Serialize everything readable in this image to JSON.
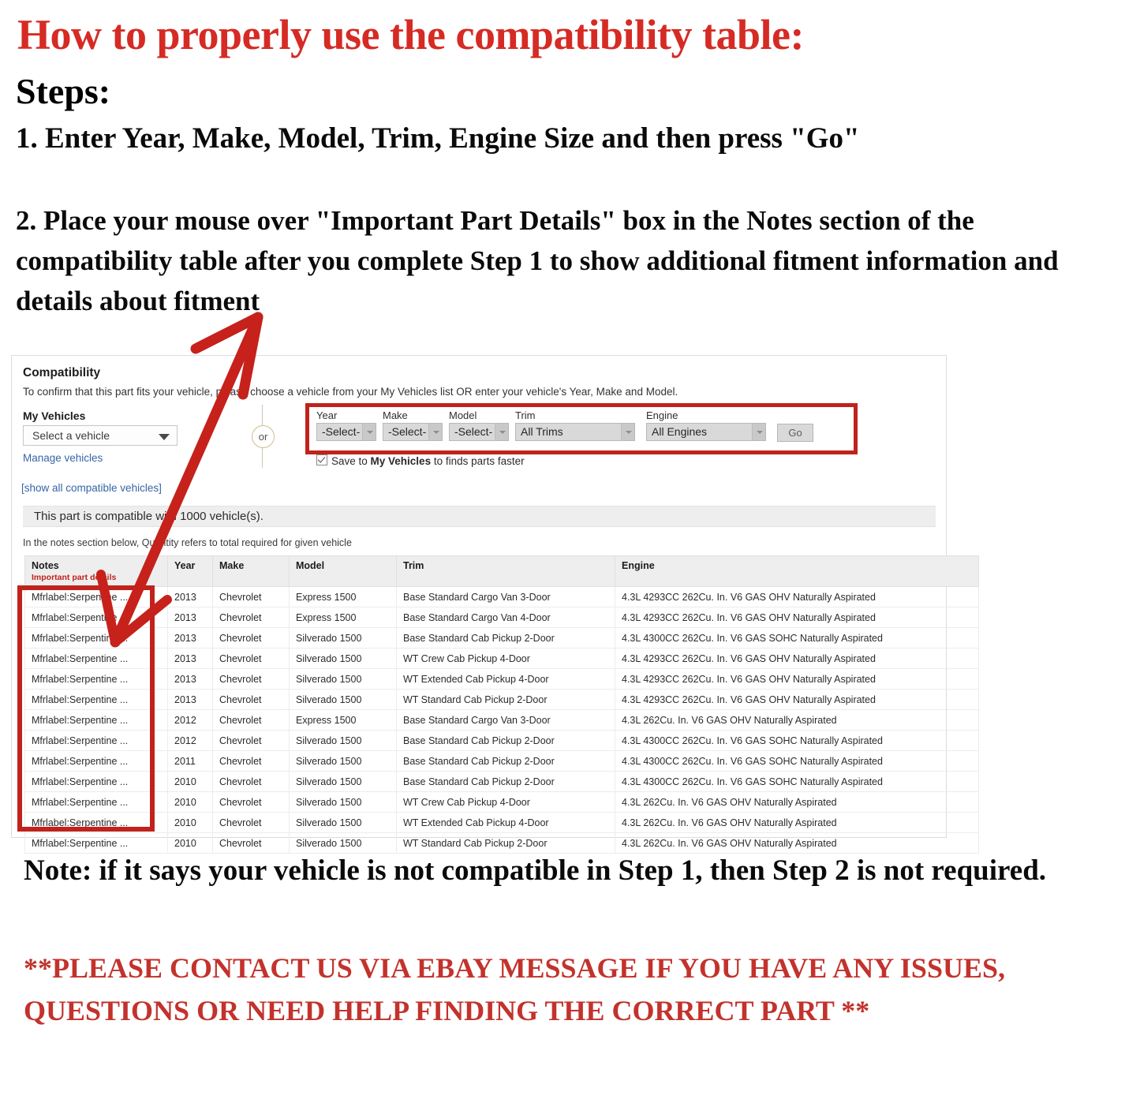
{
  "headline": "How to properly use the compatibility table:",
  "steps_label": "Steps:",
  "step1": "1. Enter Year, Make, Model, Trim, Engine Size and then press \"Go\"",
  "step2": "2. Place your mouse over \"Important Part Details\" box in the Notes section of the compatibility table after you complete Step 1 to show additional fitment information and details about fitment",
  "bottom_note": "Note: if it says your vehicle is not compatible in Step 1, then Step 2 is not required.",
  "contact_note": "**PLEASE CONTACT US VIA EBAY MESSAGE IF YOU HAVE ANY ISSUES, QUESTIONS OR NEED HELP FINDING THE CORRECT PART **",
  "colors": {
    "accent_red": "#c0221c",
    "headline_red": "#d52b24",
    "link_blue": "#3665a6",
    "banner_gray": "#eeeeee"
  },
  "panel": {
    "title": "Compatibility",
    "subtitle": "To confirm that this part fits your vehicle, please choose a vehicle from your My Vehicles list OR enter your vehicle's Year, Make and Model.",
    "my_vehicles_label": "My Vehicles",
    "vehicle_select_value": "Select a vehicle",
    "manage_vehicles_link": "Manage vehicles",
    "show_all_link": "[show all compatible vehicles]",
    "or_badge": "or",
    "compatible_banner": "This part is compatible with 1000 vehicle(s).",
    "quantity_note": "In the notes section below, Quantity refers to total required for given vehicle",
    "finder": {
      "fields": [
        {
          "label": "Year",
          "value": "-Select-"
        },
        {
          "label": "Make",
          "value": "-Select-"
        },
        {
          "label": "Model",
          "value": "-Select-"
        },
        {
          "label": "Trim",
          "value": "All Trims"
        },
        {
          "label": "Engine",
          "value": "All Engines"
        }
      ],
      "go_label": "Go",
      "save_prefix": "Save to ",
      "save_bold": "My Vehicles",
      "save_suffix": " to finds parts faster",
      "save_checked": true
    }
  },
  "table": {
    "headers": {
      "notes": "Notes",
      "notes_sub": "Important part details",
      "year": "Year",
      "make": "Make",
      "model": "Model",
      "trim": "Trim",
      "engine": "Engine"
    },
    "rows": [
      {
        "notes": "Mfrlabel:Serpentine ...",
        "year": "2013",
        "make": "Chevrolet",
        "model": "Express 1500",
        "trim": "Base Standard Cargo Van 3-Door",
        "engine": "4.3L 4293CC 262Cu. In. V6 GAS OHV Naturally Aspirated"
      },
      {
        "notes": "Mfrlabel:Serpentine ...",
        "year": "2013",
        "make": "Chevrolet",
        "model": "Express 1500",
        "trim": "Base Standard Cargo Van 4-Door",
        "engine": "4.3L 4293CC 262Cu. In. V6 GAS OHV Naturally Aspirated"
      },
      {
        "notes": "Mfrlabel:Serpentine ...",
        "year": "2013",
        "make": "Chevrolet",
        "model": "Silverado 1500",
        "trim": "Base Standard Cab Pickup 2-Door",
        "engine": "4.3L 4300CC 262Cu. In. V6 GAS SOHC Naturally Aspirated"
      },
      {
        "notes": "Mfrlabel:Serpentine ...",
        "year": "2013",
        "make": "Chevrolet",
        "model": "Silverado 1500",
        "trim": "WT Crew Cab Pickup 4-Door",
        "engine": "4.3L 4293CC 262Cu. In. V6 GAS OHV Naturally Aspirated"
      },
      {
        "notes": "Mfrlabel:Serpentine ...",
        "year": "2013",
        "make": "Chevrolet",
        "model": "Silverado 1500",
        "trim": "WT Extended Cab Pickup 4-Door",
        "engine": "4.3L 4293CC 262Cu. In. V6 GAS OHV Naturally Aspirated"
      },
      {
        "notes": "Mfrlabel:Serpentine ...",
        "year": "2013",
        "make": "Chevrolet",
        "model": "Silverado 1500",
        "trim": "WT Standard Cab Pickup 2-Door",
        "engine": "4.3L 4293CC 262Cu. In. V6 GAS OHV Naturally Aspirated"
      },
      {
        "notes": "Mfrlabel:Serpentine ...",
        "year": "2012",
        "make": "Chevrolet",
        "model": "Express 1500",
        "trim": "Base Standard Cargo Van 3-Door",
        "engine": "4.3L 262Cu. In. V6 GAS OHV Naturally Aspirated"
      },
      {
        "notes": "Mfrlabel:Serpentine ...",
        "year": "2012",
        "make": "Chevrolet",
        "model": "Silverado 1500",
        "trim": "Base Standard Cab Pickup 2-Door",
        "engine": "4.3L 4300CC 262Cu. In. V6 GAS SOHC Naturally Aspirated"
      },
      {
        "notes": "Mfrlabel:Serpentine ...",
        "year": "2011",
        "make": "Chevrolet",
        "model": "Silverado 1500",
        "trim": "Base Standard Cab Pickup 2-Door",
        "engine": "4.3L 4300CC 262Cu. In. V6 GAS SOHC Naturally Aspirated"
      },
      {
        "notes": "Mfrlabel:Serpentine ...",
        "year": "2010",
        "make": "Chevrolet",
        "model": "Silverado 1500",
        "trim": "Base Standard Cab Pickup 2-Door",
        "engine": "4.3L 4300CC 262Cu. In. V6 GAS SOHC Naturally Aspirated"
      },
      {
        "notes": "Mfrlabel:Serpentine ...",
        "year": "2010",
        "make": "Chevrolet",
        "model": "Silverado 1500",
        "trim": "WT Crew Cab Pickup 4-Door",
        "engine": "4.3L 262Cu. In. V6 GAS OHV Naturally Aspirated"
      },
      {
        "notes": "Mfrlabel:Serpentine ...",
        "year": "2010",
        "make": "Chevrolet",
        "model": "Silverado 1500",
        "trim": "WT Extended Cab Pickup 4-Door",
        "engine": "4.3L 262Cu. In. V6 GAS OHV Naturally Aspirated"
      },
      {
        "notes": "Mfrlabel:Serpentine ...",
        "year": "2010",
        "make": "Chevrolet",
        "model": "Silverado 1500",
        "trim": "WT Standard Cab Pickup 2-Door",
        "engine": "4.3L 262Cu. In. V6 GAS OHV Naturally Aspirated"
      }
    ]
  }
}
